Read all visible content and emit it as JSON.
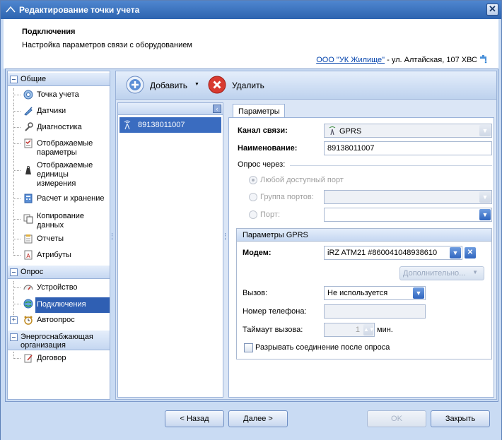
{
  "window": {
    "title": "Редактирование точки учета",
    "close_glyph": "✕"
  },
  "header": {
    "title": "Подключения",
    "subtitle": "Настройка параметров связи с оборудованием",
    "org_link": "ООО \"УК Жилище\"",
    "address": " - ул. Алтайская, 107 ХВС"
  },
  "nav": {
    "groups": [
      {
        "label": "Общие"
      },
      {
        "label": "Опрос"
      },
      {
        "label": "Энергоснабжающая организация"
      }
    ],
    "items": [
      {
        "label": "Точка учета",
        "icon": "meter-point-icon"
      },
      {
        "label": "Датчики",
        "icon": "sensor-icon"
      },
      {
        "label": "Диагностика",
        "icon": "diagnostics-icon"
      },
      {
        "label": "Отображаемые параметры",
        "icon": "checklist-icon"
      },
      {
        "label": "Отображаемые единицы измерения",
        "icon": "weight-icon"
      },
      {
        "label": "Расчет и хранение",
        "icon": "calculator-icon"
      },
      {
        "label": "Копирование данных",
        "icon": "copy-icon"
      },
      {
        "label": "Отчеты",
        "icon": "report-icon"
      },
      {
        "label": "Атрибуты",
        "icon": "attributes-icon"
      },
      {
        "label": "Устройство",
        "icon": "device-icon"
      },
      {
        "label": "Подключения",
        "icon": "connections-icon"
      },
      {
        "label": "Автоопрос",
        "icon": "alarm-clock-icon"
      },
      {
        "label": "Договор",
        "icon": "contract-icon"
      }
    ]
  },
  "toolbar": {
    "add_label": "Добавить",
    "add_dropdown_glyph": "▼",
    "delete_label": "Удалить"
  },
  "list": {
    "collapse_glyph": "‹",
    "rows": [
      {
        "label": "89138011007",
        "icon": "antenna-icon"
      }
    ]
  },
  "props": {
    "tab_label": "Параметры",
    "channel_label": "Канал связи:",
    "channel_value": "GPRS",
    "name_label": "Наименование:",
    "name_value": "89138011007",
    "poll_via_label": "Опрос через:",
    "radio_any_port": "Любой доступный порт",
    "radio_port_group": "Группа портов:",
    "radio_port": "Порт:",
    "gprs": {
      "header": "Параметры GPRS",
      "modem_label": "Модем:",
      "modem_value": "iRZ ATM21 #860041048938610",
      "more_button": "Дополнительно...",
      "call_label": "Вызов:",
      "call_value": "Не используется",
      "phone_label": "Номер телефона:",
      "phone_value": "",
      "timeout_label": "Таймаут вызова:",
      "timeout_value": "1",
      "timeout_unit": "мин.",
      "disconnect_label": "Разрывать соединение после опроса"
    }
  },
  "footer": {
    "back": "< Назад",
    "next": "Далее >",
    "ok": "OK",
    "close": "Закрыть"
  },
  "colors": {
    "selection": "#2f5fb3",
    "title_bar": "#2d64b0",
    "link": "#0645ad"
  }
}
